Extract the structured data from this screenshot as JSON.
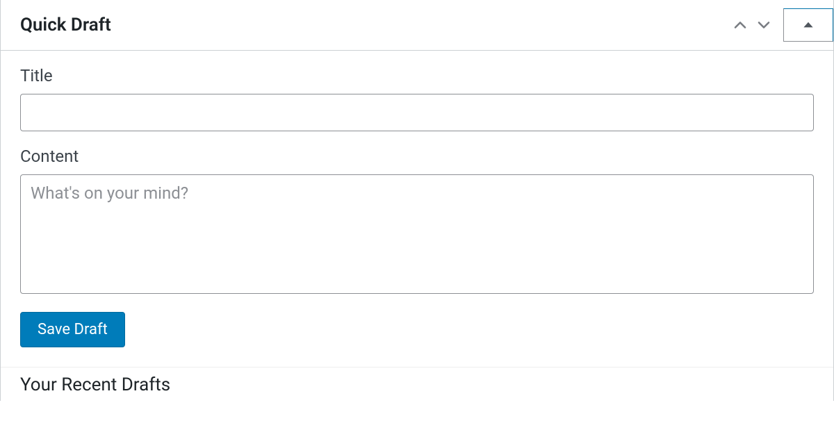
{
  "panel": {
    "title": "Quick Draft",
    "form": {
      "title_label": "Title",
      "title_value": "",
      "content_label": "Content",
      "content_value": "",
      "content_placeholder": "What's on your mind?",
      "save_label": "Save Draft"
    },
    "recent_drafts_heading": "Your Recent Drafts"
  }
}
